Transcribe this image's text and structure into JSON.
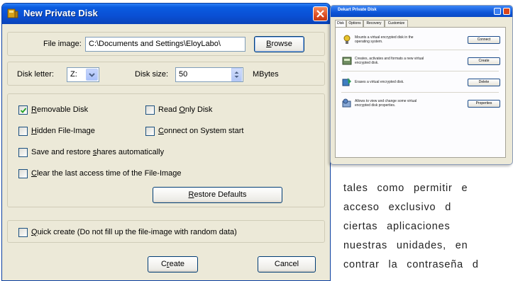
{
  "dialog": {
    "title": "New Private Disk",
    "file_image": {
      "label": "File image:",
      "value": "C:\\Documents and Settings\\EloyLabo\\",
      "browse_label": "Browse"
    },
    "disk_letter": {
      "label": "Disk letter:",
      "value": "Z:"
    },
    "disk_size": {
      "label": "Disk size:",
      "value": "50",
      "unit": "MBytes"
    },
    "options": {
      "removable_disk": {
        "label": "Removable Disk",
        "checked": true
      },
      "read_only_disk": {
        "label": "Read Only Disk",
        "checked": false
      },
      "hidden_file_image": {
        "label": "Hidden File-Image",
        "checked": false
      },
      "connect_on_start": {
        "label": "Connect on System start",
        "checked": false
      },
      "save_restore_shares": {
        "label": "Save and restore shares automatically",
        "checked": false
      },
      "clear_last_access": {
        "label": "Clear the last access time of the File-Image",
        "checked": false
      }
    },
    "restore_defaults_label": "Restore Defaults",
    "quick_create": {
      "label": "Quick create (Do not fill up the file-image with random data)",
      "checked": false
    },
    "create_label": "Create",
    "cancel_label": "Cancel"
  },
  "screenshot": {
    "title": "Dekart Private Disk",
    "tabs": [
      "Disk",
      "Options",
      "Recovery",
      "Customize"
    ],
    "rows": [
      {
        "desc": "Mounts a virtual encrypted disk in the operating system.",
        "button": "Connect",
        "icon": "key-icon"
      },
      {
        "desc": "Creates, activates and formats a new virtual encrypted disk.",
        "button": "Create",
        "icon": "disk-icon"
      },
      {
        "desc": "Erases a virtual encrypted disk.",
        "button": "Delete",
        "icon": "erase-icon"
      },
      {
        "desc": "Allows to view and change some virtual encrypted disk properties.",
        "button": "Properties",
        "icon": "properties-icon"
      }
    ]
  },
  "article": {
    "lines": [
      "tales como permitir e",
      "acceso exclusivo d",
      "ciertas aplicaciones",
      "nuestras unidades, en",
      "contrar la contraseña d"
    ]
  },
  "colors": {
    "title_bar": "#0a4fd4",
    "dialog_bg": "#ece9d8",
    "close_button": "#d9461c"
  }
}
